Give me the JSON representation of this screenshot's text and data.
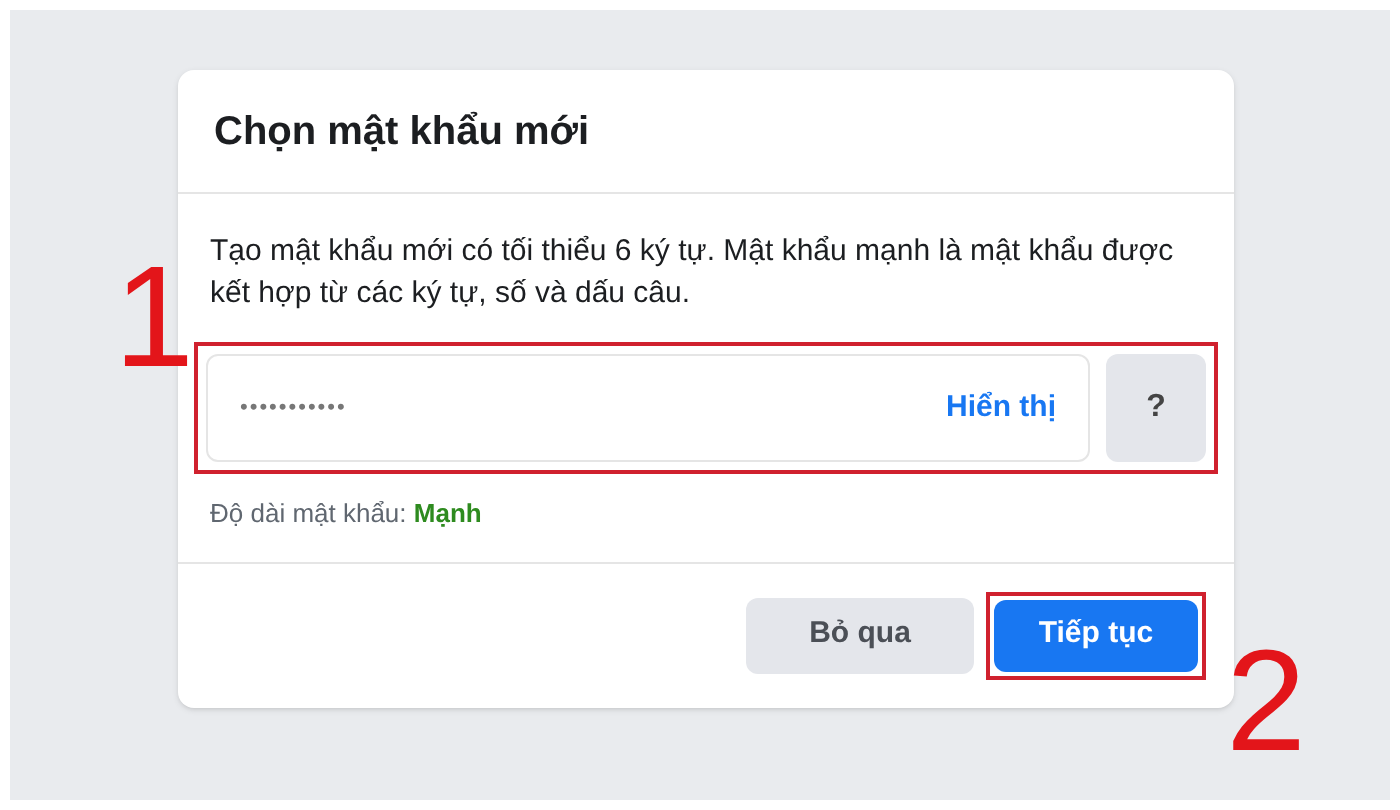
{
  "dialog": {
    "title": "Chọn mật khẩu mới",
    "description": "Tạo mật khẩu mới có tối thiểu 6 ký tự. Mật khẩu mạnh là mật khẩu được kết hợp từ các ký tự, số và dấu câu.",
    "password_field": {
      "value": "•••••••••••",
      "show_link": "Hiển thị",
      "help_button": "?"
    },
    "strength": {
      "label": "Độ dài mật khẩu:",
      "value": "Mạnh"
    },
    "buttons": [
      {
        "label": "Bỏ qua",
        "kind": "secondary"
      },
      {
        "label": "Tiếp tục",
        "kind": "primary"
      }
    ]
  },
  "annotations": [
    {
      "text": "1"
    },
    {
      "text": "2"
    }
  ]
}
